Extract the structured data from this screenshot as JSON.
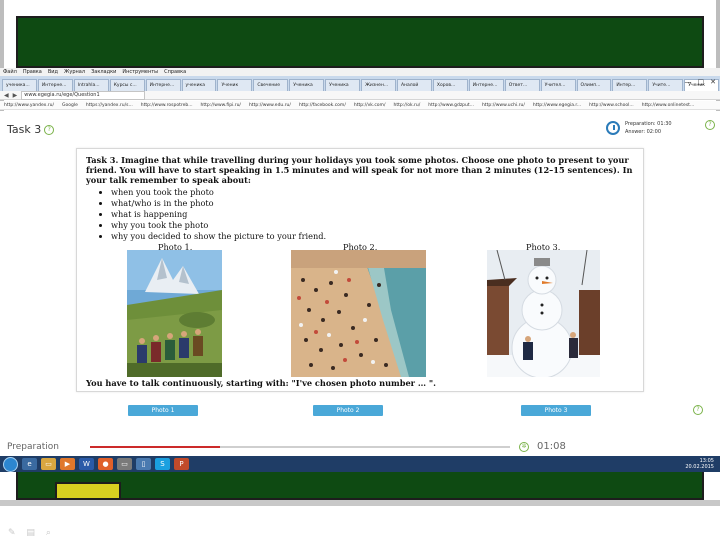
{
  "browser": {
    "menu_items": [
      "Файл",
      "Правка",
      "Вид",
      "Журнал",
      "Закладки",
      "Инструменты",
      "Справка"
    ],
    "tabs": [
      "ученика...",
      "Интерне...",
      "Intrahla...",
      "Курсы с...",
      "Интерне...",
      "ученика",
      "Ученик",
      "Свечение",
      "Ученика",
      "Ученика",
      "Жизнен...",
      "Аналой",
      "Хоров...",
      "Интерне...",
      "Ответ...",
      "Учител...",
      "Олимп...",
      "Интер...",
      "Учите...",
      "Ученик"
    ],
    "url": "www.egegia.ru/ege/Question1",
    "bookmarks": [
      "http://www.yandex.ru/",
      "Google",
      "https://yandex.ru/s...",
      "http://www.rospotreb...",
      "http://www.fipi.ru/",
      "http://www.edu.ru/",
      "http://facebook.com/",
      "http://vk.com/",
      "http://ok.ru/",
      "http://www.gdzput...",
      "http://www.uchi.ru/",
      "http://www.egegia.r...",
      "http://www.school...",
      "http://www.onlinetest..."
    ]
  },
  "header": {
    "task_title": "Task 3",
    "timer_line1": "Preparation: 01:30",
    "timer_line2": "Answer: 02:00"
  },
  "task": {
    "instruction": "Task 3. Imagine that while travelling during your holidays you took some photos. Choose one photo to present to your friend. You will have to start speaking in 1.5 minutes and will speak for not more than 2 minutes (12–15 sentences). In your talk remember to speak about:",
    "bullets": [
      "when you took the photo",
      "what/who is in the photo",
      "what is happening",
      "why you took the photo",
      "why you decided to show the picture to your friend."
    ],
    "photo_labels": [
      "Photo 1.",
      "Photo 2.",
      "Photo 3."
    ],
    "closing": "You have to talk continuously, starting with: \"I've chosen photo number … \"."
  },
  "buttons": [
    "Photo 1",
    "Photo 2",
    "Photo 3"
  ],
  "status": {
    "label": "Preparation",
    "time": "01:08",
    "progress": 0.31
  },
  "taskbar": {
    "clock_time": "13:05",
    "clock_date": "20.02.2015"
  },
  "colors": {
    "board_green": "#0e4a12",
    "button_blue": "#4aa8d8",
    "progress_red": "#cc2a2a",
    "taskbar": "#1f3d66"
  }
}
